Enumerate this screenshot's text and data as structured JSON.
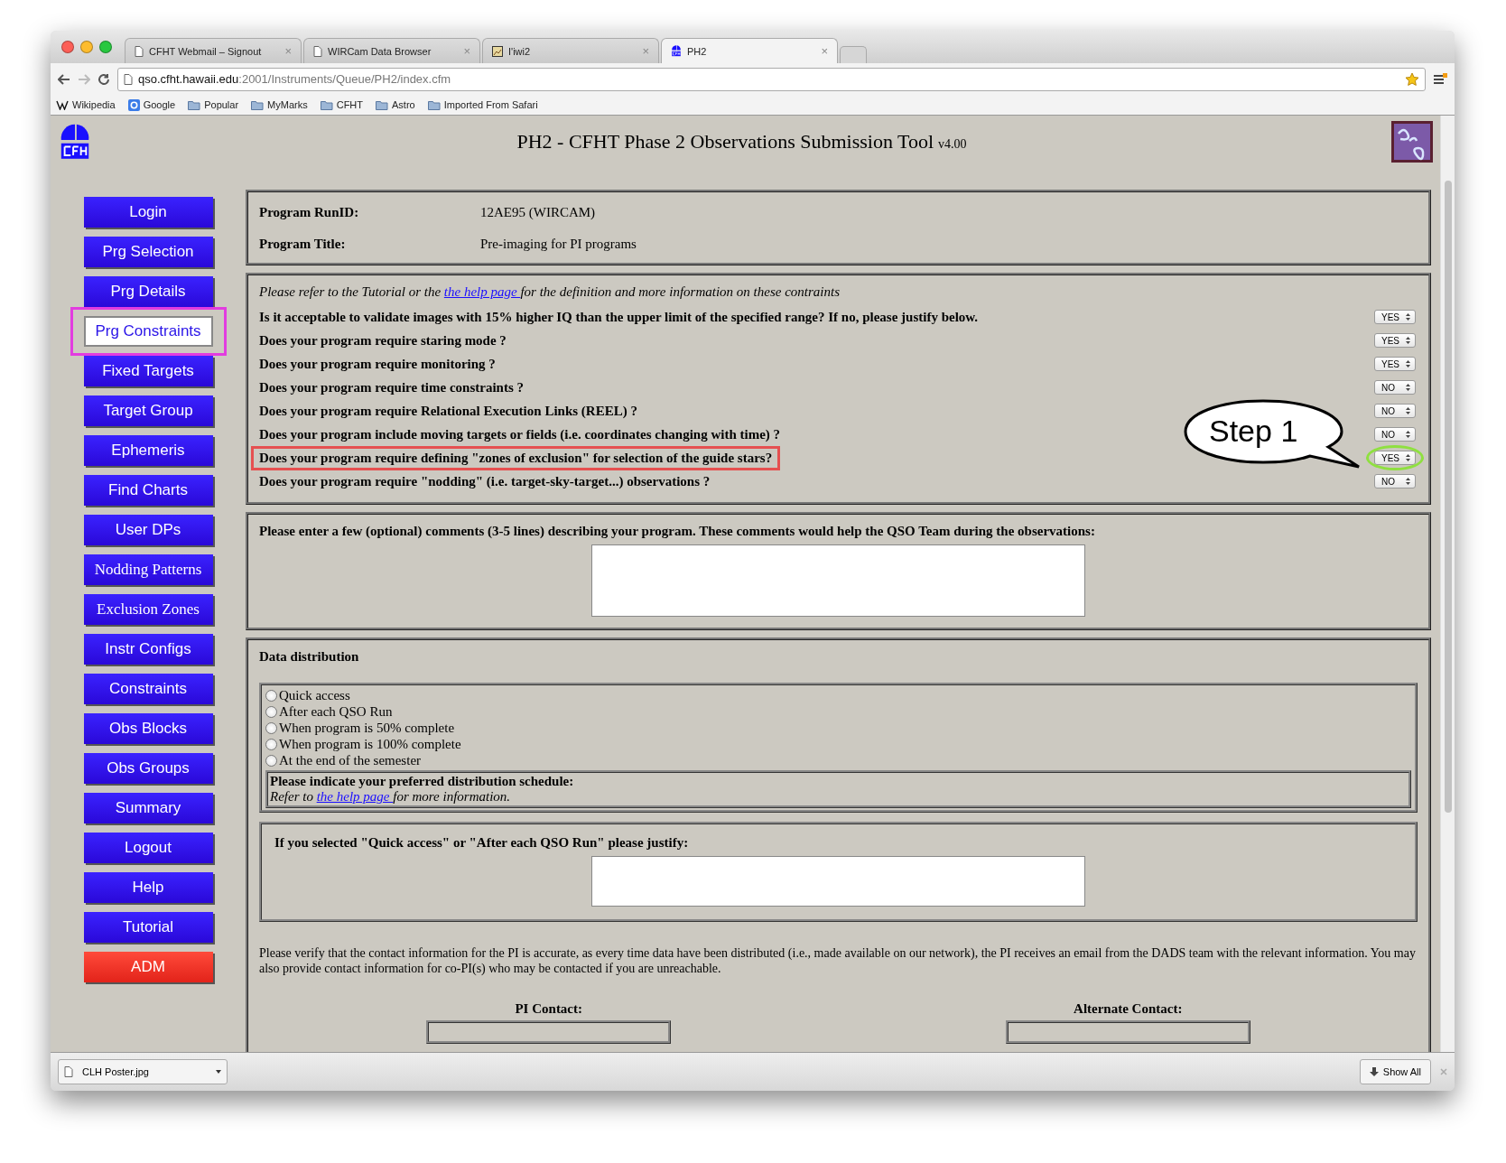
{
  "browser": {
    "tabs": [
      {
        "title": "CFHT Webmail – Signout",
        "close": "×",
        "selected": false
      },
      {
        "title": "WIRCam Data Browser",
        "close": "×",
        "selected": false
      },
      {
        "title": "I'iwi2",
        "close": "×",
        "selected": false
      },
      {
        "title": "PH2",
        "close": "×",
        "selected": true
      }
    ],
    "url_host": "qso.cfht.hawaii.edu",
    "url_path": ":2001/Instruments/Queue/PH2/index.cfm",
    "bookmarks": [
      {
        "label": "Wikipedia"
      },
      {
        "label": "Google"
      },
      {
        "label": "Popular"
      },
      {
        "label": "MyMarks"
      },
      {
        "label": "CFHT"
      },
      {
        "label": "Astro"
      },
      {
        "label": "Imported From Safari"
      }
    ]
  },
  "header": {
    "title": "PH2 - CFHT Phase 2 Observations Submission Tool",
    "version": "v4.00"
  },
  "sidebar": {
    "items": [
      {
        "label": "Login",
        "kind": "default",
        "selected": false,
        "annotated": false
      },
      {
        "label": "Prg Selection",
        "kind": "default",
        "selected": false,
        "annotated": false
      },
      {
        "label": "Prg Details",
        "kind": "default",
        "selected": false,
        "annotated": false
      },
      {
        "label": "Prg Constraints",
        "kind": "default",
        "selected": true,
        "annotated": true
      },
      {
        "label": "Fixed Targets",
        "kind": "default",
        "selected": false,
        "annotated": false
      },
      {
        "label": "Target Group",
        "kind": "default",
        "selected": false,
        "annotated": false
      },
      {
        "label": "Ephemeris",
        "kind": "default",
        "selected": false,
        "annotated": false
      },
      {
        "label": "Find Charts",
        "kind": "default",
        "selected": false,
        "annotated": false
      },
      {
        "label": "User DPs",
        "kind": "default",
        "selected": false,
        "annotated": false
      },
      {
        "label": "Nodding Patterns",
        "kind": "serif",
        "selected": false,
        "annotated": false
      },
      {
        "label": "Exclusion Zones",
        "kind": "serif",
        "selected": false,
        "annotated": false
      },
      {
        "label": "Instr Configs",
        "kind": "default",
        "selected": false,
        "annotated": false
      },
      {
        "label": "Constraints",
        "kind": "default",
        "selected": false,
        "annotated": false
      },
      {
        "label": "Obs Blocks",
        "kind": "default",
        "selected": false,
        "annotated": false
      },
      {
        "label": "Obs Groups",
        "kind": "default",
        "selected": false,
        "annotated": false
      },
      {
        "label": "Summary",
        "kind": "default",
        "selected": false,
        "annotated": false
      },
      {
        "label": "Logout",
        "kind": "default",
        "selected": false,
        "annotated": false
      },
      {
        "label": "Help",
        "kind": "default",
        "selected": false,
        "annotated": false
      },
      {
        "label": "Tutorial",
        "kind": "default",
        "selected": false,
        "annotated": false
      },
      {
        "label": "ADM",
        "kind": "danger",
        "selected": false,
        "annotated": false
      }
    ]
  },
  "program": [
    {
      "label": "Program RunID:",
      "value": "12AE95 (WIRCAM)"
    },
    {
      "label": "Program Title:",
      "value": "Pre-imaging for PI programs"
    }
  ],
  "constraints": {
    "intro_before": "Please refer to the Tutorial or the ",
    "intro_link": "the help page ",
    "intro_after": "for the definition and more information on these contraints",
    "questions": [
      {
        "text": "Is it acceptable to validate images with 15% higher IQ than the upper limit of the specified range? If no, please justify below.",
        "answer": "YES",
        "highlighted": false,
        "circled": false
      },
      {
        "text": "Does your program require staring mode ?",
        "answer": "YES",
        "highlighted": false,
        "circled": false
      },
      {
        "text": "Does your program require monitoring ?",
        "answer": "YES",
        "highlighted": false,
        "circled": false
      },
      {
        "text": "Does your program require time constraints ?",
        "answer": "NO",
        "highlighted": false,
        "circled": false
      },
      {
        "text": "Does your program require Relational Execution Links (REEL) ?",
        "answer": "NO",
        "highlighted": false,
        "circled": false
      },
      {
        "text": "Does your program include moving targets or fields (i.e. coordinates changing with time) ?",
        "answer": "NO",
        "highlighted": false,
        "circled": false
      },
      {
        "text": "Does your program require defining \"zones of exclusion\" for selection of the guide stars?",
        "answer": "YES",
        "highlighted": true,
        "circled": true
      },
      {
        "text": "Does your program require \"nodding\" (i.e. target-sky-target...) observations ?",
        "answer": "NO",
        "highlighted": false,
        "circled": false
      }
    ],
    "callout": "Step 1"
  },
  "comments": {
    "prompt": "Please enter a few (optional) comments (3-5 lines) describing your program. These comments would help the QSO Team during the observations:"
  },
  "distribution": {
    "title": "Data distribution",
    "options": [
      {
        "label": "Quick access",
        "selected": false
      },
      {
        "label": "After each QSO Run",
        "selected": false
      },
      {
        "label": "When program is 50% complete",
        "selected": false
      },
      {
        "label": "When program is 100% complete",
        "selected": false
      },
      {
        "label": "At the end of the semester",
        "selected": false
      }
    ],
    "hint_title": "Please indicate your preferred distribution schedule:",
    "hint_before": "Refer to ",
    "hint_link": "the help page ",
    "hint_after": "for more information.",
    "justify_prompt": "If you selected \"Quick access\" or \"After each QSO Run\" please justify:",
    "notice": "Please verify that the contact information for the PI is accurate, as every time data have been distributed (i.e., made available on our network), the PI receives an email from the DADS team with the relevant information. You may also provide contact information for co-PI(s) who may be contacted if you are unreachable.",
    "contacts": [
      "PI Contact:",
      "Alternate Contact:"
    ]
  },
  "downloads": {
    "file": "CLH Poster.jpg",
    "show_all": "Show All"
  }
}
